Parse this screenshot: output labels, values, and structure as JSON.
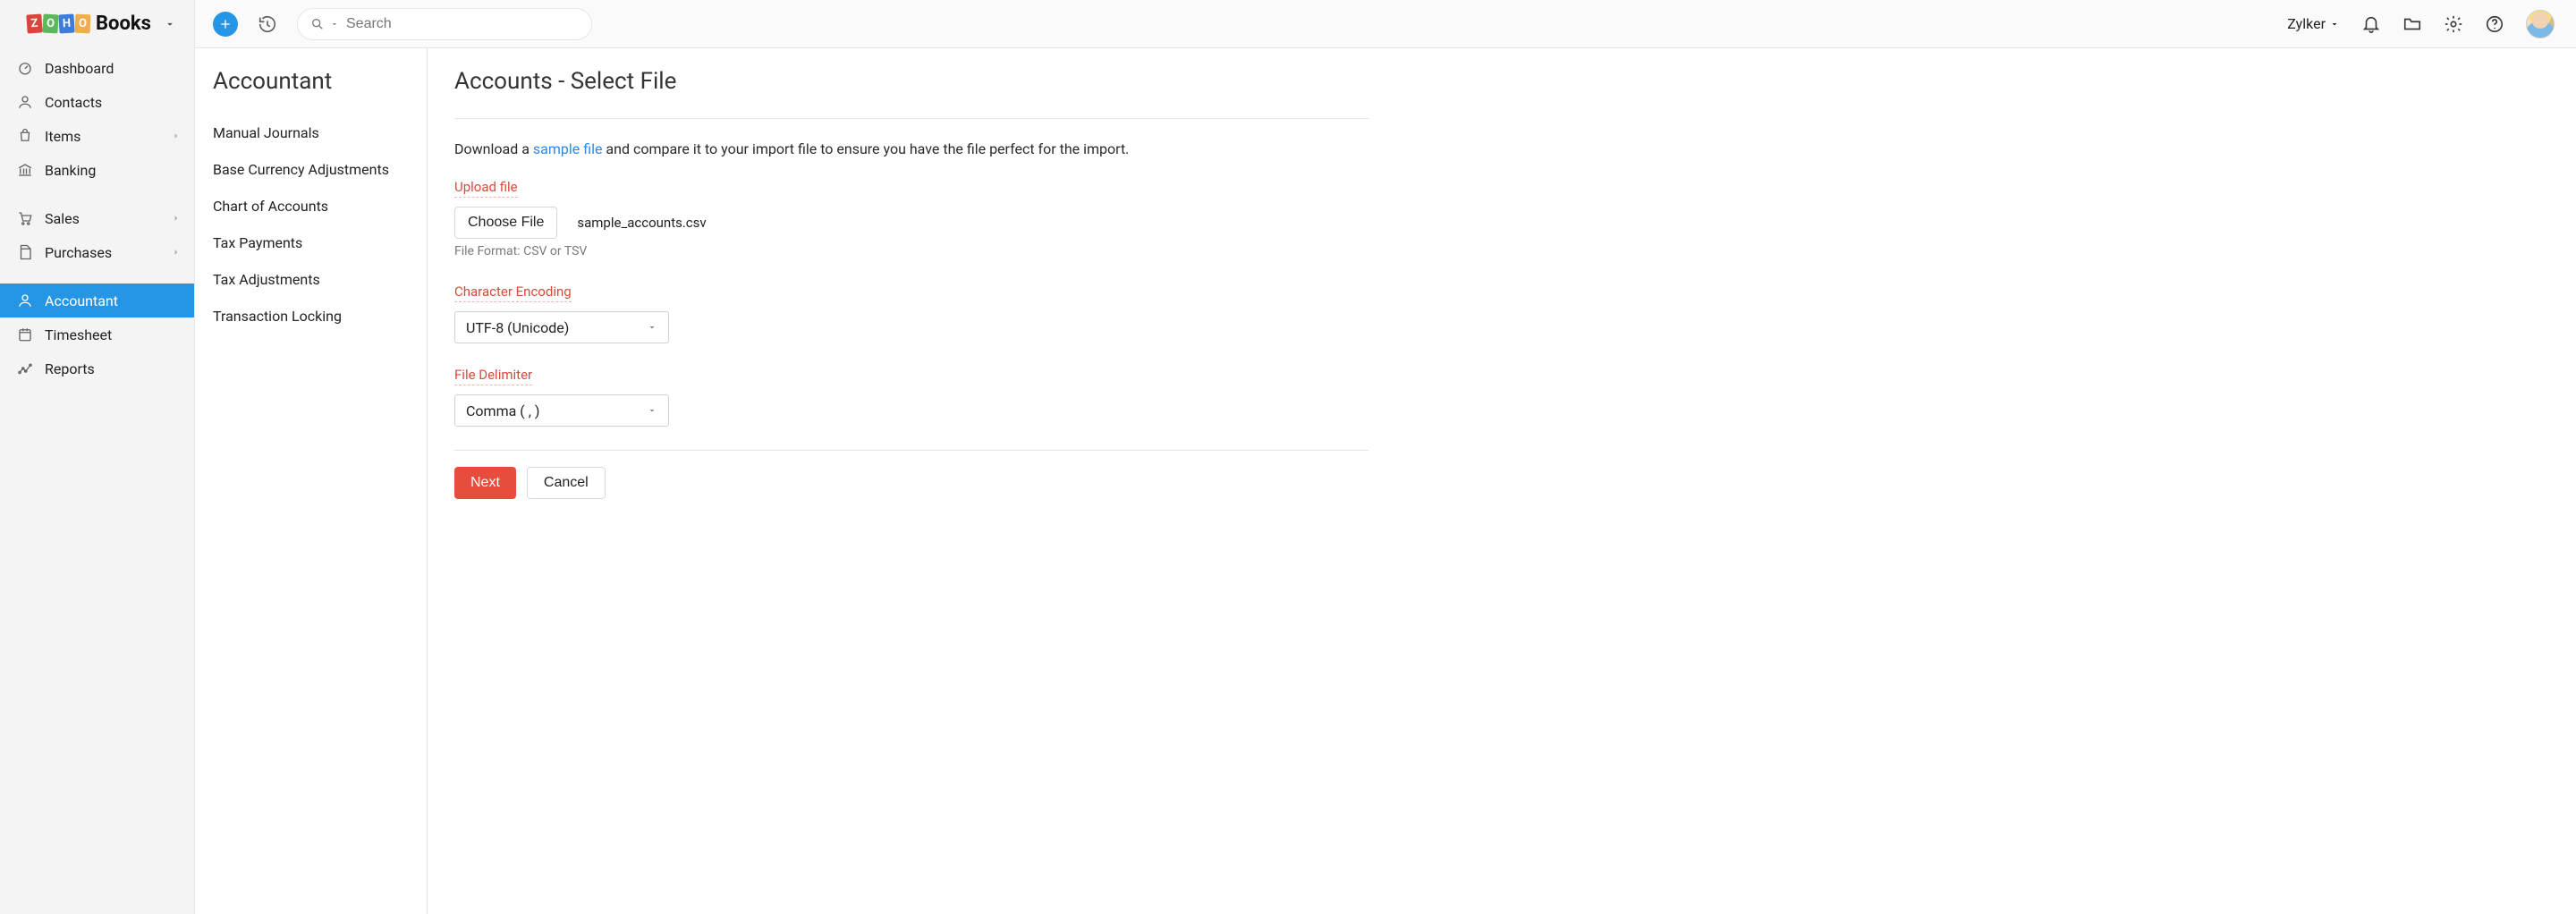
{
  "brand": {
    "name": "Books",
    "logo_letters": [
      "Z",
      "O",
      "H",
      "O"
    ]
  },
  "topbar": {
    "search_placeholder": "Search",
    "org_name": "Zylker"
  },
  "sidebar": {
    "items": [
      {
        "label": "Dashboard",
        "icon": "dashboard-icon",
        "expandable": false
      },
      {
        "label": "Contacts",
        "icon": "contacts-icon",
        "expandable": false
      },
      {
        "label": "Items",
        "icon": "items-icon",
        "expandable": true
      },
      {
        "label": "Banking",
        "icon": "banking-icon",
        "expandable": false
      },
      {
        "label": "Sales",
        "icon": "sales-icon",
        "expandable": true
      },
      {
        "label": "Purchases",
        "icon": "purchases-icon",
        "expandable": true
      },
      {
        "label": "Accountant",
        "icon": "accountant-icon",
        "expandable": false,
        "active": true
      },
      {
        "label": "Timesheet",
        "icon": "timesheet-icon",
        "expandable": false
      },
      {
        "label": "Reports",
        "icon": "reports-icon",
        "expandable": false
      }
    ]
  },
  "subnav": {
    "title": "Accountant",
    "items": [
      "Manual Journals",
      "Base Currency Adjustments",
      "Chart of Accounts",
      "Tax Payments",
      "Tax Adjustments",
      "Transaction Locking"
    ]
  },
  "page": {
    "title": "Accounts - Select File",
    "hint_before": "Download a ",
    "hint_link": "sample file",
    "hint_after": " and compare it to your import file to ensure you have the file perfect for the import.",
    "upload_label": "Upload file",
    "choose_btn": "Choose File",
    "chosen_file": "sample_accounts.csv",
    "format_hint": "File Format: CSV or TSV",
    "encoding_label": "Character Encoding",
    "encoding_value": "UTF-8 (Unicode)",
    "delimiter_label": "File Delimiter",
    "delimiter_value": "Comma ( , )",
    "next": "Next",
    "cancel": "Cancel"
  }
}
